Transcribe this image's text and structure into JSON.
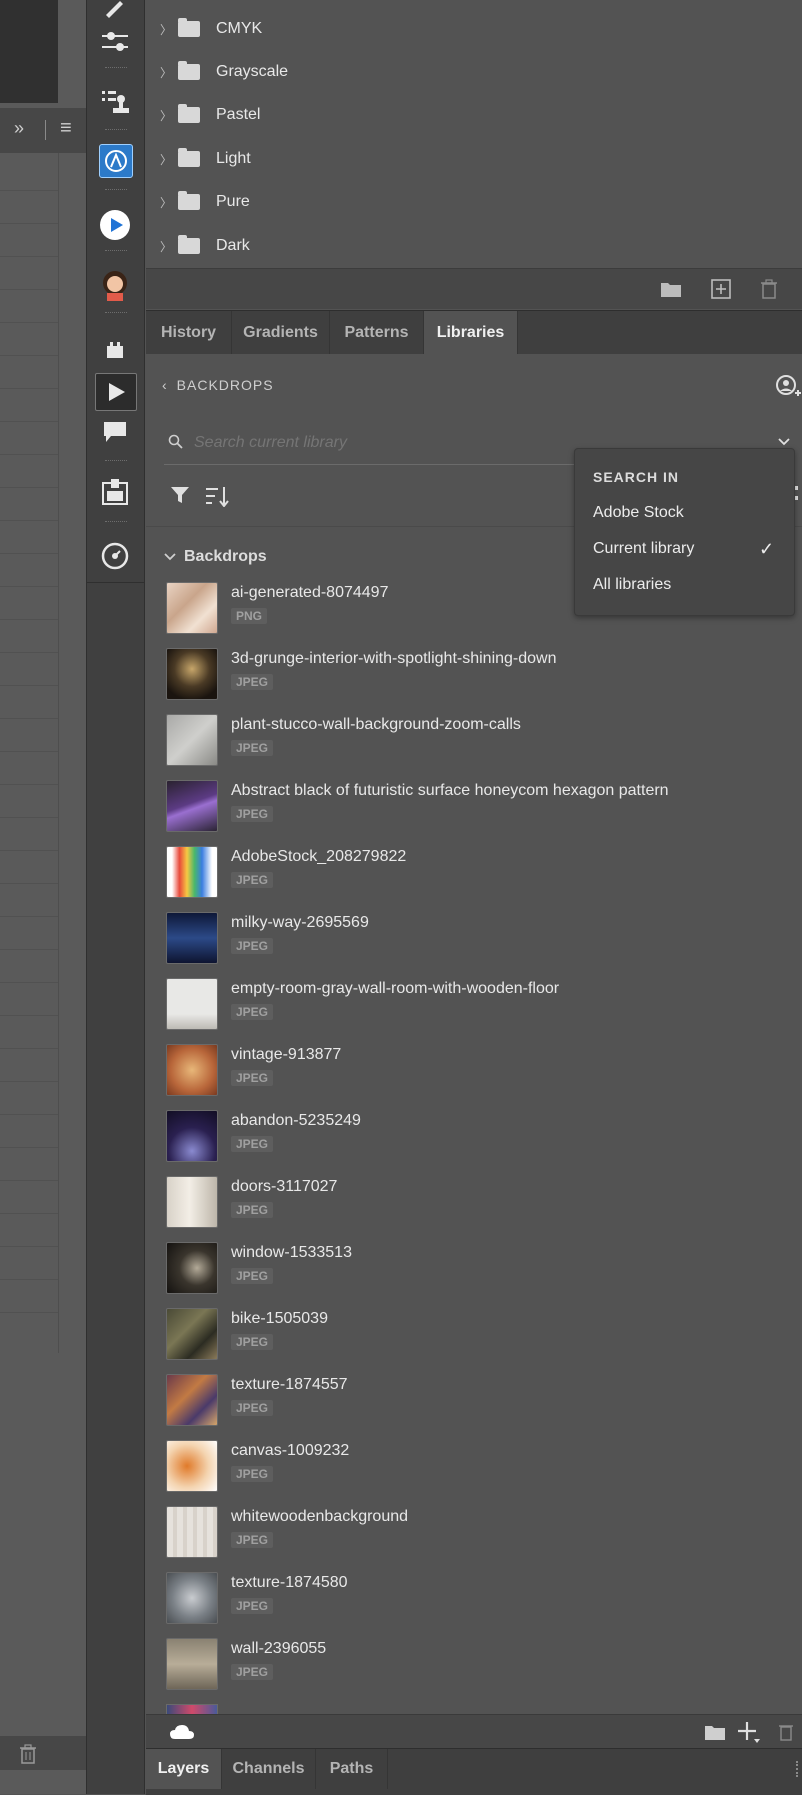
{
  "left_panel": {
    "expand_glyph": "»",
    "menu_glyph": "≡",
    "trash_icon": "trash-icon"
  },
  "tools": [
    {
      "name": "brush-icon"
    },
    {
      "name": "adjust-icon"
    },
    {
      "name": "stamp-list-icon"
    },
    {
      "name": "app-a-icon"
    },
    {
      "name": "play-circle-icon"
    },
    {
      "name": "avatar-icon"
    },
    {
      "name": "plugin-icon"
    },
    {
      "name": "actions-play-icon"
    },
    {
      "name": "comment-icon"
    },
    {
      "name": "export-icon"
    },
    {
      "name": "navigator-icon"
    }
  ],
  "swatch_folders": [
    {
      "label": "CMYK"
    },
    {
      "label": "Grayscale"
    },
    {
      "label": "Pastel"
    },
    {
      "label": "Light"
    },
    {
      "label": "Pure"
    },
    {
      "label": "Dark"
    }
  ],
  "tabs": [
    {
      "label": "History"
    },
    {
      "label": "Gradients"
    },
    {
      "label": "Patterns"
    },
    {
      "label": "Libraries",
      "active": true
    }
  ],
  "library": {
    "back_label": "BACKDROPS",
    "search_placeholder": "Search current library",
    "group_title": "Backdrops",
    "items": [
      {
        "name": "ai-generated-8074497",
        "type": "PNG"
      },
      {
        "name": "3d-grunge-interior-with-spotlight-shining-down",
        "type": "JPEG"
      },
      {
        "name": "plant-stucco-wall-background-zoom-calls",
        "type": "JPEG"
      },
      {
        "name": "Abstract black of futuristic surface honeycom hexagon pattern",
        "type": "JPEG"
      },
      {
        "name": "AdobeStock_208279822",
        "type": "JPEG"
      },
      {
        "name": "milky-way-2695569",
        "type": "JPEG"
      },
      {
        "name": "empty-room-gray-wall-room-with-wooden-floor",
        "type": "JPEG"
      },
      {
        "name": "vintage-913877",
        "type": "JPEG"
      },
      {
        "name": "abandon-5235249",
        "type": "JPEG"
      },
      {
        "name": "doors-3117027",
        "type": "JPEG"
      },
      {
        "name": "window-1533513",
        "type": "JPEG"
      },
      {
        "name": "bike-1505039",
        "type": "JPEG"
      },
      {
        "name": "texture-1874557",
        "type": "JPEG"
      },
      {
        "name": "canvas-1009232",
        "type": "JPEG"
      },
      {
        "name": "whitewoodenbackground",
        "type": "JPEG"
      },
      {
        "name": "texture-1874580",
        "type": "JPEG"
      },
      {
        "name": "wall-2396055",
        "type": "JPEG"
      }
    ]
  },
  "search_dropdown": {
    "heading": "SEARCH IN",
    "options": [
      {
        "label": "Adobe Stock"
      },
      {
        "label": "Current library",
        "checked": true
      },
      {
        "label": "All libraries"
      }
    ],
    "check_glyph": "✓"
  },
  "bottom_tabs": [
    {
      "label": "Layers",
      "active": true
    },
    {
      "label": "Channels"
    },
    {
      "label": "Paths"
    }
  ]
}
